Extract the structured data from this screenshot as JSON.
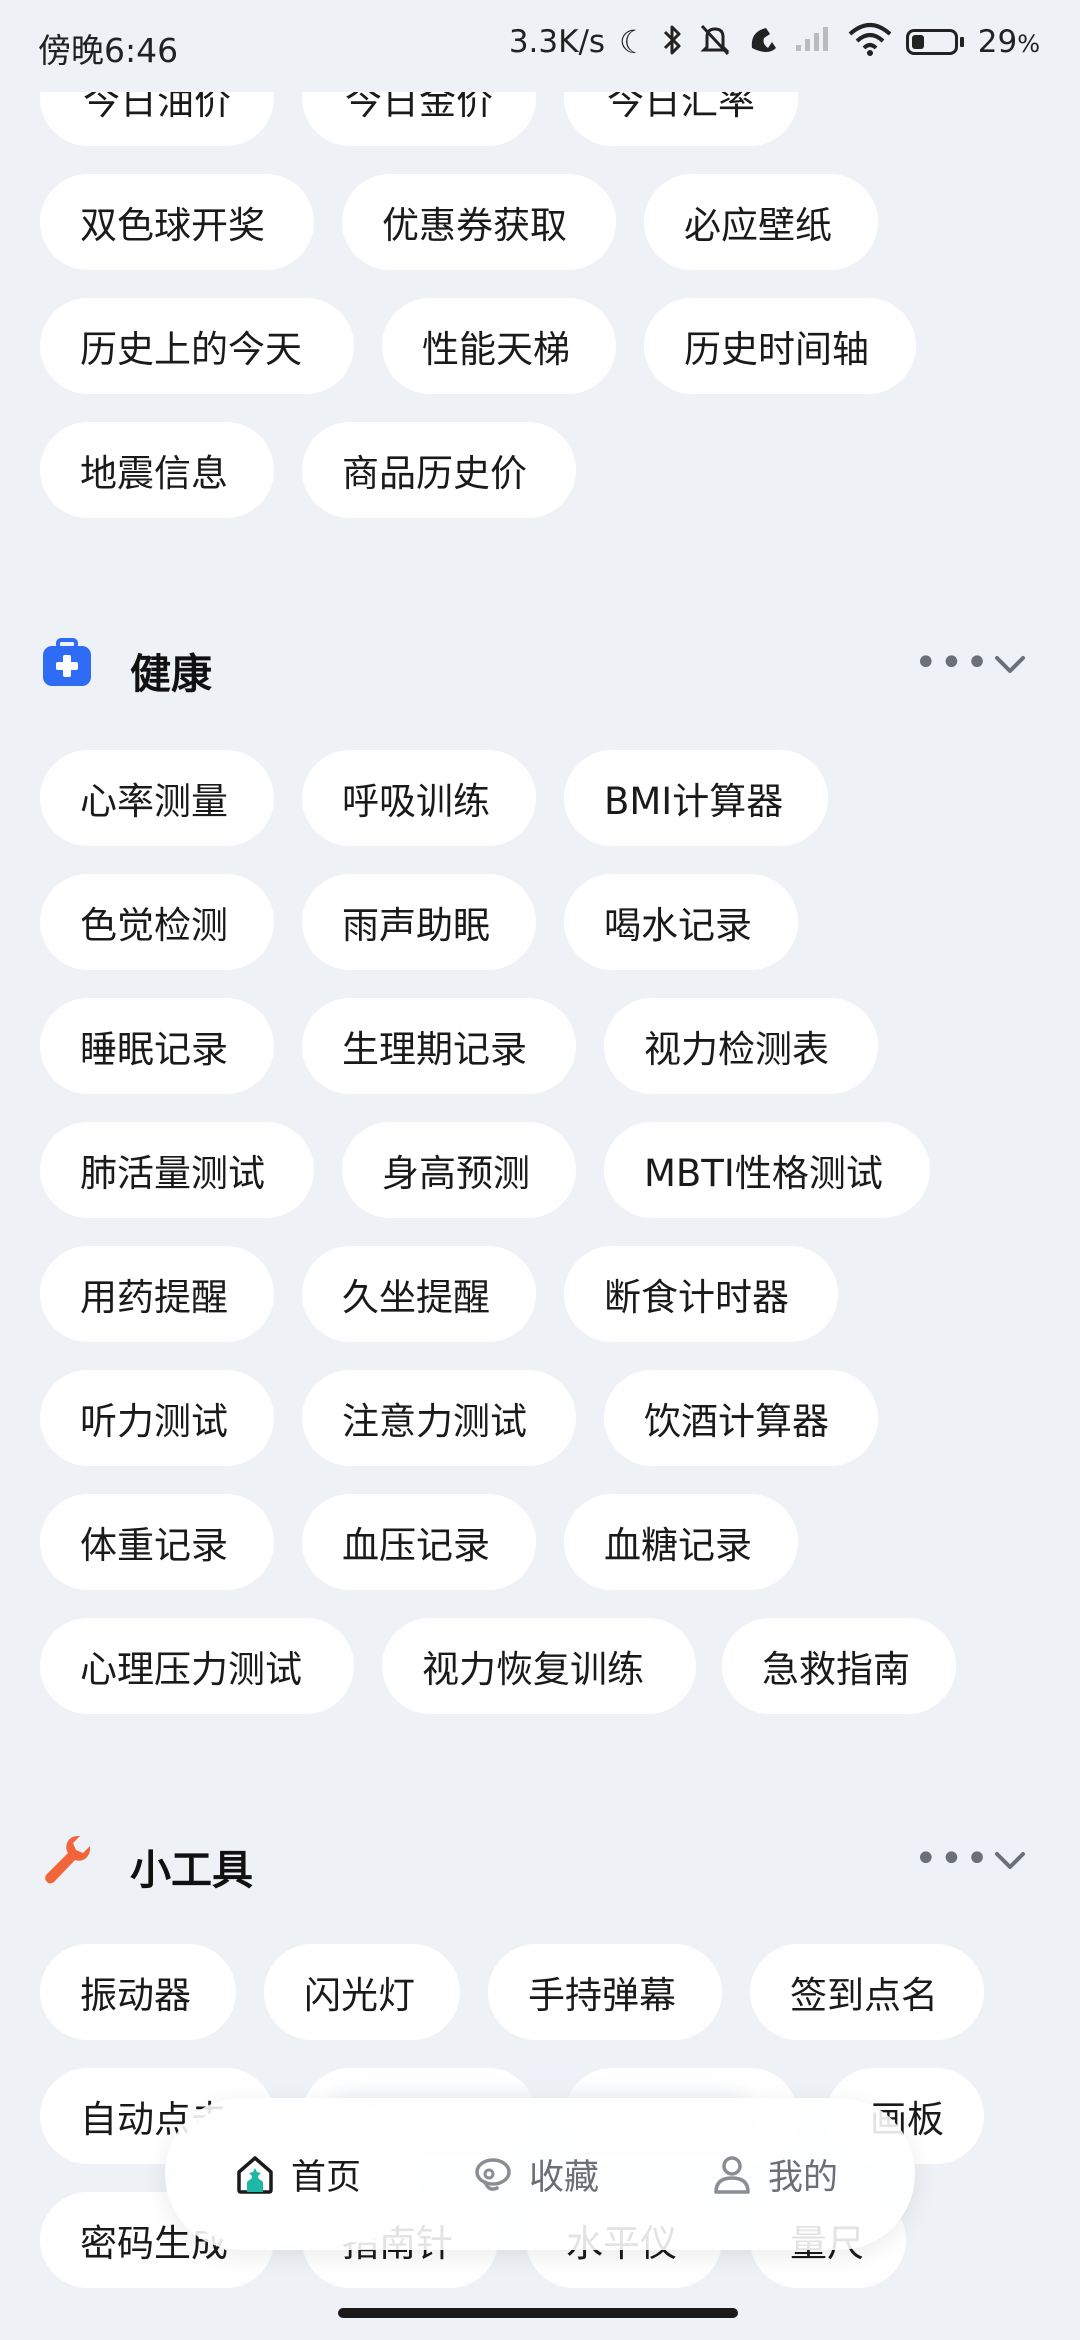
{
  "status_bar": {
    "time": "傍晚6:46",
    "speed": "3.3K/s",
    "battery": "29",
    "battery_unit": "%"
  },
  "top_partial_chips": [
    "今日油价",
    "今日金价",
    "今日汇率"
  ],
  "top_chips": [
    [
      "双色球开奖",
      "优惠券获取",
      "必应壁纸"
    ],
    [
      "历史上的今天",
      "性能天梯",
      "历史时间轴"
    ],
    [
      "地震信息",
      "商品历史价"
    ]
  ],
  "health": {
    "title": "健康",
    "more": "•••",
    "icon": "medical-kit-icon",
    "color": "#2f6cf6",
    "rows": [
      [
        "心率测量",
        "呼吸训练",
        "BMI计算器"
      ],
      [
        "色觉检测",
        "雨声助眠",
        "喝水记录"
      ],
      [
        "睡眠记录",
        "生理期记录",
        "视力检测表"
      ],
      [
        "肺活量测试",
        "身高预测",
        "MBTI性格测试"
      ],
      [
        "用药提醒",
        "久坐提醒",
        "断食计时器"
      ],
      [
        "听力测试",
        "注意力测试",
        "饮酒计算器"
      ],
      [
        "体重记录",
        "血压记录",
        "血糖记录"
      ],
      [
        "心理压力测试",
        "视力恢复训练",
        "急救指南"
      ]
    ]
  },
  "tools": {
    "title": "小工具",
    "more": "•••",
    "icon": "wrench-icon",
    "color": "#f2643a",
    "row1": [
      "振动器",
      "闪光灯",
      "手持弹幕",
      "签到点名"
    ],
    "row2_visible": [
      "自动点击",
      "画板"
    ],
    "row3_visible": [
      "密码生成",
      "指南针",
      "水平仪",
      "量尺"
    ]
  },
  "nav": {
    "home": "首页",
    "favorites": "收藏",
    "mine": "我的",
    "accent": "#1fb7a6"
  }
}
